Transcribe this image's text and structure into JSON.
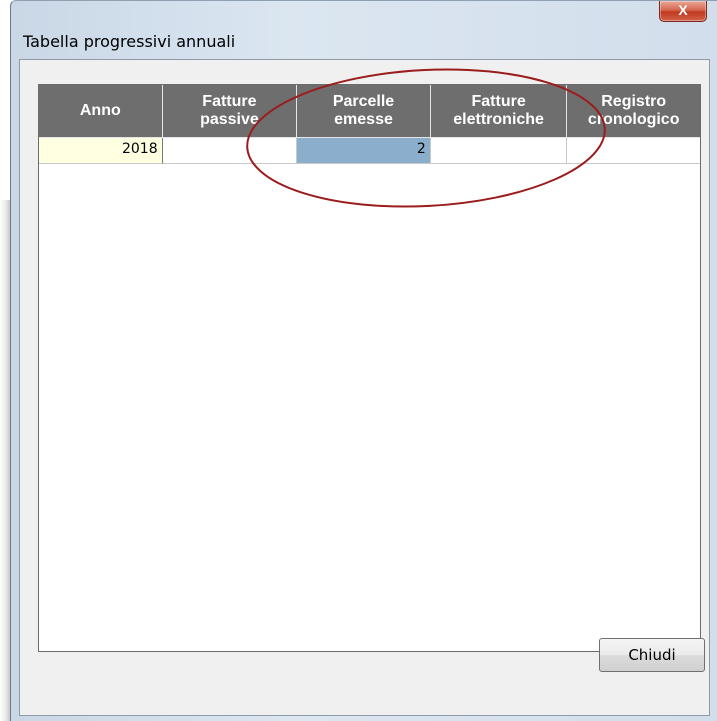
{
  "window": {
    "title": "Tabella progressivi annuali",
    "close_glyph": "X"
  },
  "grid": {
    "columns": [
      "Anno",
      "Fatture\npassive",
      "Parcelle\nemesse",
      "Fatture\nelettroniche",
      "Registro\ncronologico"
    ],
    "rows": [
      [
        "2018",
        "",
        "2",
        "",
        ""
      ]
    ],
    "selected_cell": "Parcelle emesse",
    "annotation_color": "#9b1c1c"
  },
  "footer": {
    "close_label": "Chiudi"
  },
  "colors": {
    "header_bg": "#6e6e6e",
    "selected_cell_bg": "#8aaecc",
    "year_cell_bg": "#ffffe1"
  }
}
